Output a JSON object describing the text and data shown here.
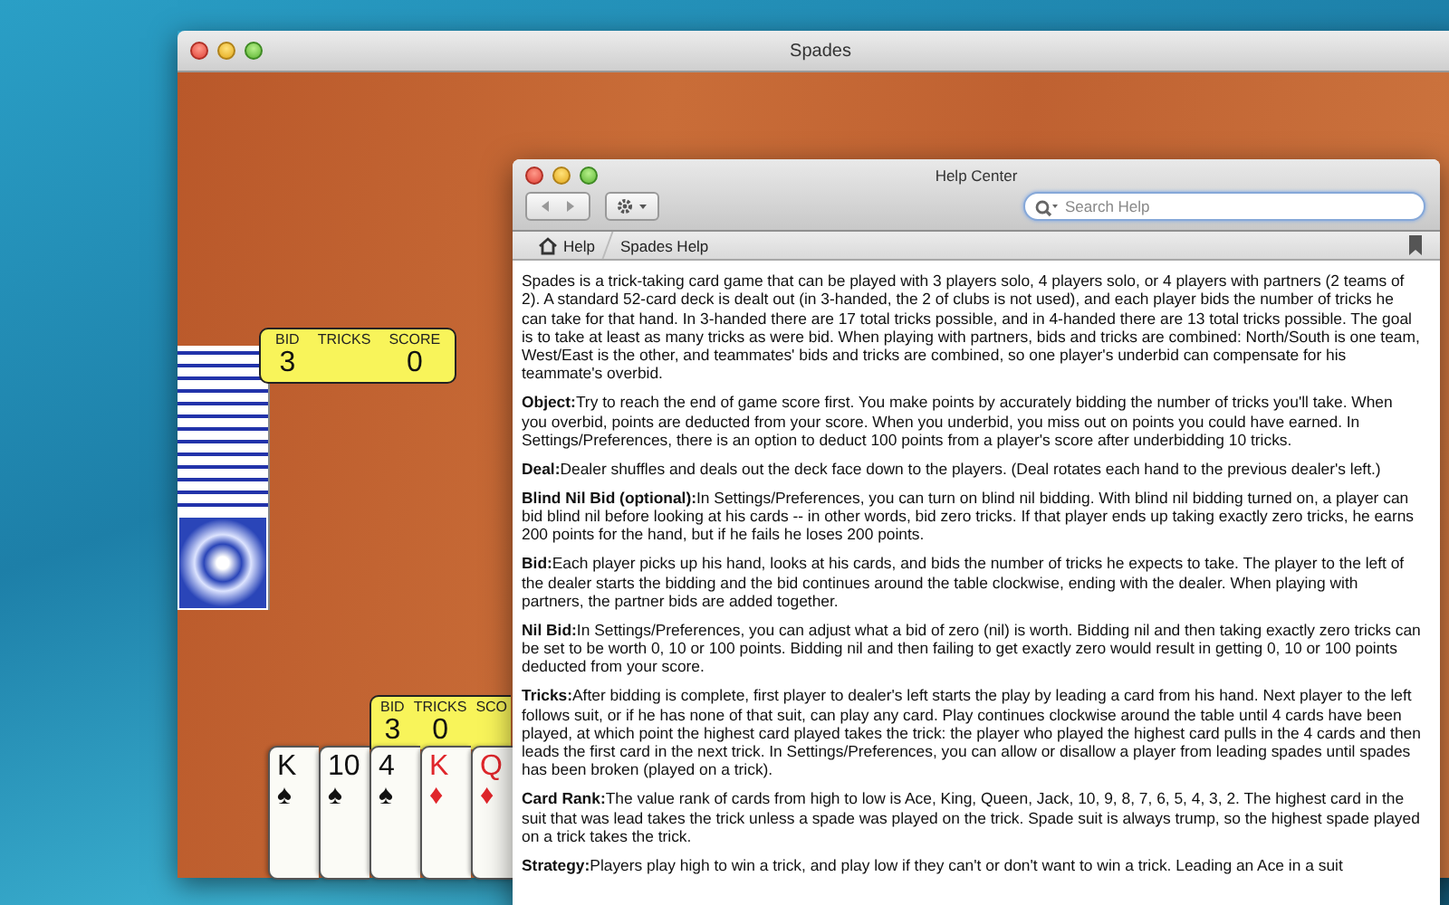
{
  "spades_window": {
    "title": "Spades",
    "opponent_score": [
      {
        "label": "BID",
        "value": "3"
      },
      {
        "label": "TRICKS"
      },
      {
        "label": "SCORE",
        "value": "0"
      }
    ],
    "player_score": [
      {
        "label": "BID",
        "value": "3"
      },
      {
        "label": "TRICKS",
        "value": "0"
      },
      {
        "label": "SCO"
      }
    ],
    "hand": [
      {
        "rank": "K",
        "suit": "♠",
        "color": "#111111"
      },
      {
        "rank": "10",
        "suit": "♠",
        "color": "#111111"
      },
      {
        "rank": "4",
        "suit": "♠",
        "color": "#111111"
      },
      {
        "rank": "K",
        "suit": "♦",
        "color": "#e0262b"
      },
      {
        "rank": "Q",
        "suit": "♦",
        "color": "#e0262b"
      }
    ]
  },
  "help_window": {
    "title": "Help Center",
    "search": {
      "placeholder": "Search Help"
    },
    "breadcrumb": [
      "Help",
      "Spades Help"
    ],
    "paragraphs": [
      {
        "text": "Spades is a trick-taking card game that can be played with 3 players solo, 4 players solo, or 4 players with partners (2 teams of 2). A standard 52-card deck is dealt out (in 3-handed, the 2 of clubs is not used), and each player bids the number of tricks he can take for that hand. In 3-handed there are 17 total tricks possible, and in 4-handed there are 13 total tricks possible. The goal is to take at least as many tricks as were bid. When playing with partners, bids and tricks are combined: North/South is one team, West/East is the other, and teammates' bids and tricks are combined, so one player's underbid can compensate for his teammate's overbid."
      },
      {
        "heading": "Object:",
        "text": "Try to reach the end of game score first. You make points by accurately bidding the number of tricks you'll take. When you overbid, points are deducted from your score. When you underbid, you miss out on points you could have earned. In Settings/Preferences, there is an option to deduct 100 points from a player's score after underbidding 10 tricks."
      },
      {
        "heading": "Deal:",
        "text": "Dealer shuffles and deals out the deck face down to the players. (Deal rotates each hand to the previous dealer's left.)"
      },
      {
        "heading": "Blind Nil Bid (optional):",
        "text": "In Settings/Preferences, you can turn on blind nil bidding. With blind nil bidding turned on, a player can bid blind nil before looking at his cards -- in other words, bid zero tricks. If that player ends up taking exactly zero tricks, he earns 200 points for the hand, but if he fails he loses 200 points."
      },
      {
        "heading": "Bid:",
        "text": "Each player picks up his hand, looks at his cards, and bids the number of tricks he expects to take. The player to the left of the dealer starts the bidding and the bid continues around the table clockwise, ending with the dealer. When playing with partners, the partner bids are added together."
      },
      {
        "heading": "Nil Bid:",
        "text": "In Settings/Preferences, you can adjust what a bid of zero (nil) is worth. Bidding nil and then taking exactly zero tricks can be set to be worth 0, 10 or 100 points. Bidding nil and then failing to get exactly zero would result in getting 0, 10 or 100 points deducted from your score."
      },
      {
        "heading": "Tricks:",
        "text": "After bidding is complete, first player to dealer's left starts the play by leading a card from his hand. Next player to the left follows suit, or if he has none of that suit, can play any card. Play continues clockwise around the table until 4 cards have been played, at which point the highest card played takes the trick: the player who played the highest card pulls in the 4 cards and then leads the first card in the next trick. In Settings/Preferences, you can allow or disallow a player from leading spades until spades has been broken (played on a trick)."
      },
      {
        "heading": "Card Rank:",
        "text": "The value rank of cards from high to low is Ace, King, Queen, Jack, 10, 9, 8, 7, 6, 5, 4, 3, 2. The highest card in the suit that was lead takes the trick unless a spade was played on the trick. Spade suit is always trump, so the highest spade played on a trick takes the trick."
      },
      {
        "heading": "Strategy:",
        "text": "Players play high to win a trick, and play low if they can't or don't want to win a trick. Leading an Ace in a suit"
      }
    ]
  }
}
